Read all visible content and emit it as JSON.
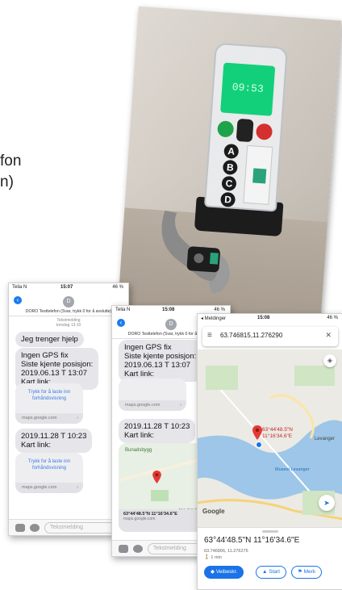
{
  "slide": {
    "text_line1": "fon",
    "text_line2": "n)"
  },
  "photo": {
    "phone_time": "09:53",
    "keys": [
      "A",
      "B",
      "C",
      "D"
    ]
  },
  "sms1": {
    "carrier": "Telia N",
    "time": "15:07",
    "battery": "46 %",
    "avatar_letter": "D",
    "contact": "DORO Testtelefon (Svar, trykk 0 for å avslutte)",
    "meta_label": "Tekstmelding",
    "meta_date": "torsdag 13:10",
    "msg_help": "Jeg trenger hjelp",
    "msg_gps": "Ingen GPS fix\nSiste kjente posisjon:\n2019.06.13 T 13:07\nKart link:",
    "link_text": "Trykk for å laste inn forhåndsvisning",
    "link_domain": "maps.google.com",
    "msg_second": "2019.11.28 T 10:23\nKart link:",
    "link2_text": "Trykk for å laste inn forhåndsvisning",
    "link2_domain": "maps.google.com",
    "input_placeholder": "Tekstmelding"
  },
  "sms2": {
    "carrier": "Telia N",
    "time": "15:08",
    "battery": "46 %",
    "avatar_letter": "D",
    "contact": "DORO Testtelefon (Svar, trykk 0 for å avslutte)",
    "msg_gps": "Ingen GPS fix\nSiste kjente posisjon:\n2019.06.13 T 13:07\nKart link:",
    "link_domain": "maps.google.com",
    "msg_second": "2019.11.28 T 10:23\nKart link:",
    "map_place": "Bunadsbygg",
    "map_data": "Map data ©2019",
    "map_coords": "63°44'48.5\"N 11°16'34.6\"E",
    "map_domain": "maps.google.com",
    "input_placeholder": "Tekstmelding"
  },
  "maps": {
    "status_left": "◂ Meldinger",
    "time": "15:08",
    "battery": "46 %",
    "search_value": "63.746815,11.276290",
    "pin_label": "63°44'48.5\"N 11°16'34.6\"E",
    "place_levanger": "Levanger",
    "place_museum": "Museet Levanger",
    "google": "Google",
    "coords_title": "63°44'48.5\"N 11°16'34.6\"E",
    "coords_sub": "63.746806, 11.276276",
    "walk_time": "1 min",
    "btn_directions": "Veibeskr.",
    "btn_start": "Start",
    "btn_save": "Merk"
  }
}
